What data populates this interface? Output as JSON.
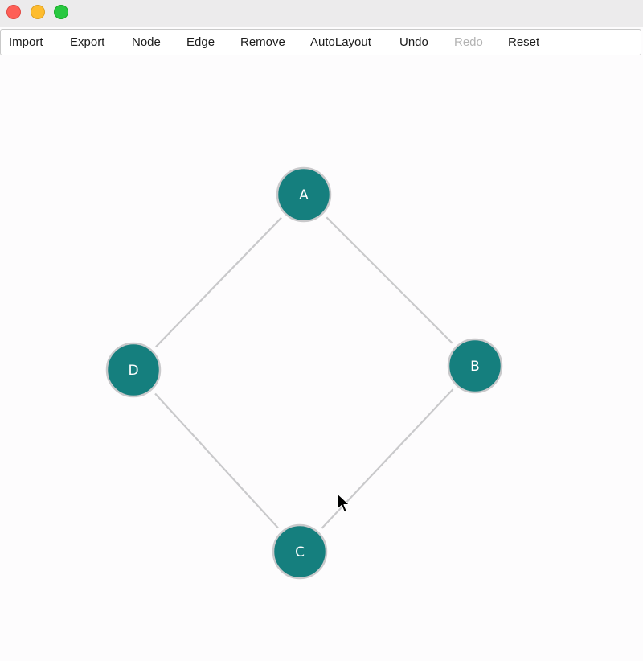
{
  "window": {
    "controls": [
      "close",
      "minimize",
      "maximize"
    ]
  },
  "menu": {
    "items": [
      {
        "label": "Import",
        "enabled": true
      },
      {
        "label": "Export",
        "enabled": true
      },
      {
        "label": "Node",
        "enabled": true
      },
      {
        "label": "Edge",
        "enabled": true
      },
      {
        "label": "Remove",
        "enabled": true
      },
      {
        "label": "AutoLayout",
        "enabled": true
      },
      {
        "label": "Undo",
        "enabled": true
      },
      {
        "label": "Redo",
        "enabled": false
      },
      {
        "label": "Reset",
        "enabled": true
      }
    ]
  },
  "graph": {
    "nodes": [
      {
        "id": "A",
        "label": "A"
      },
      {
        "id": "B",
        "label": "B"
      },
      {
        "id": "C",
        "label": "C"
      },
      {
        "id": "D",
        "label": "D"
      }
    ],
    "edges": [
      {
        "from": "A",
        "to": "B"
      },
      {
        "from": "B",
        "to": "C"
      },
      {
        "from": "C",
        "to": "D"
      },
      {
        "from": "D",
        "to": "A"
      }
    ]
  },
  "colors": {
    "node_fill": "#157f7e",
    "node_stroke": "#c9c9cb",
    "edge": "#c9c9cb",
    "label": "#ffffff"
  },
  "cursor": {
    "icon": "arrow-cursor-icon"
  }
}
